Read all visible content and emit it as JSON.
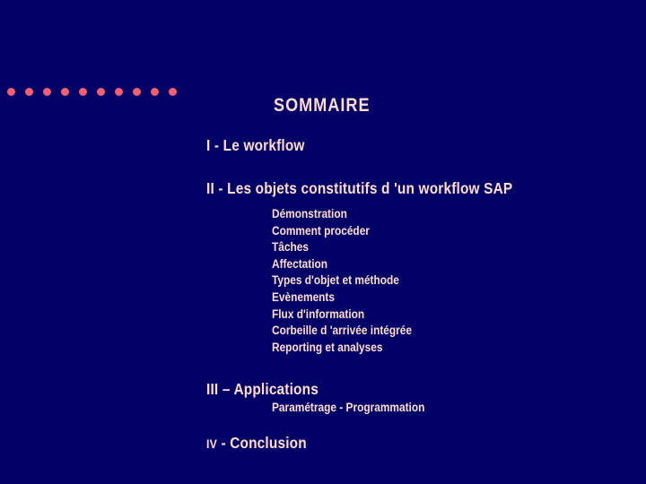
{
  "slide": {
    "background_color": "#000066",
    "text_color": "#ffddcc",
    "accent_color": "#f2606f",
    "title": "SOMMAIRE"
  },
  "decor": {
    "dot_count": 10,
    "dot_color": "#f2606f"
  },
  "outline": {
    "section_1": "I - Le workflow",
    "section_2": "II - Les objets constitutifs d 'un workflow SAP",
    "section_2_items": [
      "Démonstration",
      "Comment procéder",
      "Tâches",
      "Affectation",
      "Types d'objet et méthode",
      "Evènements",
      "Flux d'information",
      "Corbeille d 'arrivée intégrée",
      "Reporting et analyses"
    ],
    "section_3": "III – Applications",
    "section_3_item": "Paramétrage - Programmation",
    "section_4_roman": "IV",
    "section_4_rest": " - Conclusion"
  }
}
